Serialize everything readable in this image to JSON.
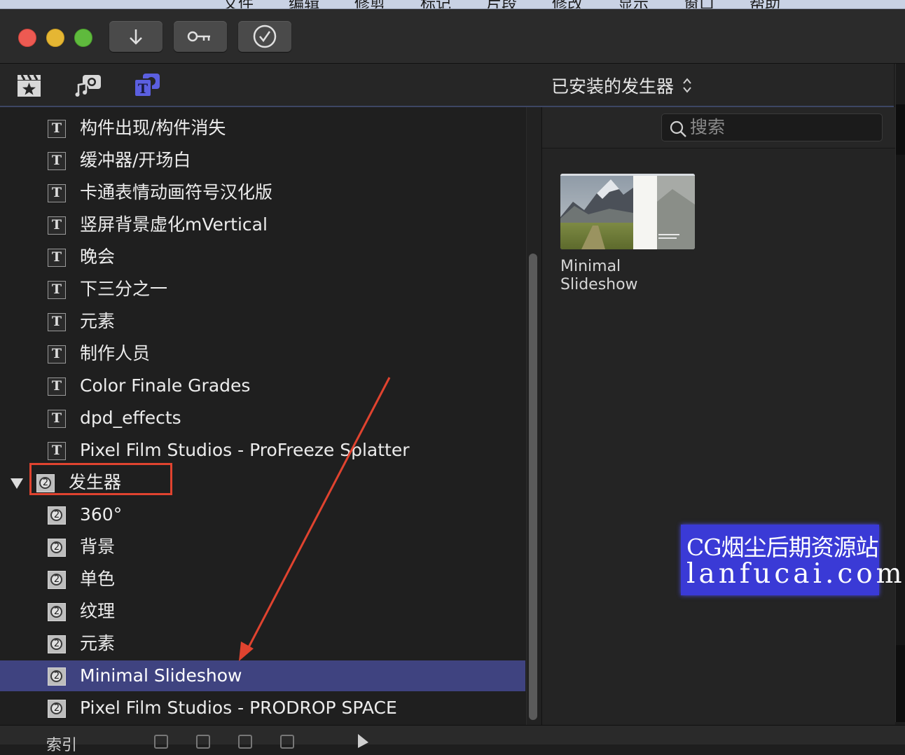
{
  "menubar": {
    "items": [
      "文件",
      "编辑",
      "修剪",
      "标记",
      "片段",
      "修改",
      "显示",
      "窗口",
      "帮助"
    ]
  },
  "toolbar": {
    "buttons": [
      {
        "name": "import-button",
        "icon": "download-arrow-icon"
      },
      {
        "name": "keywords-button",
        "icon": "key-icon"
      },
      {
        "name": "background-tasks-button",
        "icon": "checkmark-circle-icon"
      }
    ]
  },
  "browser": {
    "tabs": [
      {
        "name": "libraries",
        "icon": "clapper-star-icon",
        "active": false
      },
      {
        "name": "photos-audio",
        "icon": "camera-music-icon",
        "active": false
      },
      {
        "name": "titles-generators",
        "icon": "titles-icon",
        "active": true
      }
    ],
    "source_select": "已安装的发生器",
    "search_placeholder": "搜索"
  },
  "sidebar": {
    "items": [
      {
        "label": "构件出现/构件消失",
        "type": "title"
      },
      {
        "label": "缓冲器/开场白",
        "type": "title"
      },
      {
        "label": "卡通表情动画符号汉化版",
        "type": "title"
      },
      {
        "label": "竖屏背景虚化mVertical",
        "type": "title"
      },
      {
        "label": "晚会",
        "type": "title"
      },
      {
        "label": "下三分之一",
        "type": "title"
      },
      {
        "label": "元素",
        "type": "title"
      },
      {
        "label": "制作人员",
        "type": "title"
      },
      {
        "label": "Color Finale Grades",
        "type": "title"
      },
      {
        "label": "dpd_effects",
        "type": "title"
      },
      {
        "label": "Pixel Film Studios - ProFreeze Splatter",
        "type": "title"
      },
      {
        "label": "发生器",
        "type": "generator-group"
      },
      {
        "label": "360°",
        "type": "generator"
      },
      {
        "label": "背景",
        "type": "generator"
      },
      {
        "label": "单色",
        "type": "generator"
      },
      {
        "label": "纹理",
        "type": "generator"
      },
      {
        "label": "元素",
        "type": "generator"
      },
      {
        "label": "Minimal Slideshow",
        "type": "generator",
        "selected": true
      },
      {
        "label": "Pixel Film Studios - PRODROP SPACE",
        "type": "generator"
      }
    ],
    "generator_icon_glyph": "2"
  },
  "content": {
    "items": [
      {
        "name": "Minimal Slideshow"
      }
    ]
  },
  "watermark": {
    "line1": "CG烟尘后期资源站",
    "line2": "lanfucai.com"
  },
  "bottom": {
    "index_label": "索引"
  },
  "colors": {
    "annotation": "#e0432f",
    "selection": "#3f4380",
    "accent": "#5b5fe0"
  }
}
